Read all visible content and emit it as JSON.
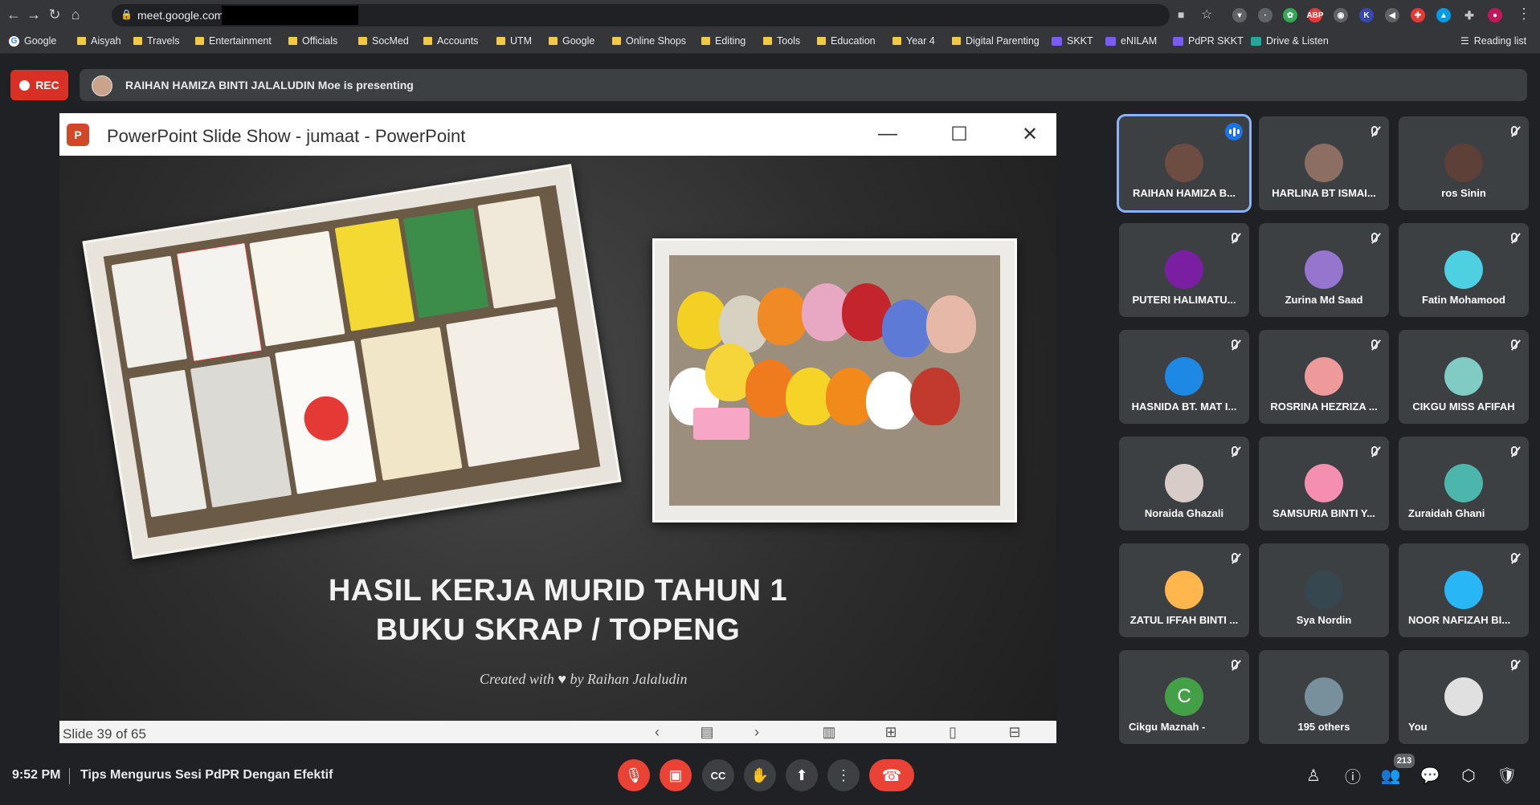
{
  "browser": {
    "url": "meet.google.com",
    "bookmarks": [
      {
        "label": "Google",
        "icon": "google-icon"
      },
      {
        "label": "Aisyah",
        "icon": "folder-icon"
      },
      {
        "label": "Travels",
        "icon": "folder-icon"
      },
      {
        "label": "Entertainment",
        "icon": "folder-icon"
      },
      {
        "label": "Officials",
        "icon": "folder-icon"
      },
      {
        "label": "SocMed",
        "icon": "folder-icon"
      },
      {
        "label": "Accounts",
        "icon": "folder-icon"
      },
      {
        "label": "UTM",
        "icon": "folder-icon"
      },
      {
        "label": "Google",
        "icon": "folder-icon"
      },
      {
        "label": "Online Shops",
        "icon": "folder-icon"
      },
      {
        "label": "Editing",
        "icon": "folder-icon"
      },
      {
        "label": "Tools",
        "icon": "folder-icon"
      },
      {
        "label": "Education",
        "icon": "folder-icon"
      },
      {
        "label": "Year 4",
        "icon": "folder-icon"
      },
      {
        "label": "Digital Parenting",
        "icon": "folder-icon"
      },
      {
        "label": "SKKT",
        "icon": "app-icon"
      },
      {
        "label": "eNILAM",
        "icon": "app-icon"
      },
      {
        "label": "PdPR SKKT",
        "icon": "app-icon"
      },
      {
        "label": "Drive & Listen",
        "icon": "drive-icon"
      }
    ],
    "reading_list": "Reading list",
    "extensions": [
      {
        "label": "ABP",
        "color": "#e53935"
      },
      {
        "label": "K",
        "color": "#3949ab"
      },
      {
        "label": "✚",
        "color": "#e53935"
      }
    ]
  },
  "meet": {
    "rec_label": "REC",
    "presenting_text": "RAIHAN HAMIZA BINTI JALALUDIN Moe is presenting",
    "time": "9:52 PM",
    "meeting_name": "Tips Mengurus Sesi PdPR Dengan Efektif",
    "participant_count_badge": "213",
    "participants": [
      {
        "name": "RAIHAN HAMIZA B...",
        "speaking": true,
        "avatar_color": "#6d4c41"
      },
      {
        "name": "HARLINA BT ISMAI...",
        "muted": true,
        "avatar_color": "#8d6e63"
      },
      {
        "name": "ros Sinin",
        "muted": true,
        "avatar_color": "#5d4037"
      },
      {
        "name": "PUTERI HALIMATU...",
        "muted": true,
        "avatar_color": "#7b1fa2"
      },
      {
        "name": "Zurina Md Saad",
        "muted": true,
        "avatar_color": "#9575cd"
      },
      {
        "name": "Fatin Mohamood",
        "muted": true,
        "avatar_color": "#4dd0e1"
      },
      {
        "name": "HASNIDA BT. MAT I...",
        "muted": true,
        "avatar_color": "#1e88e5"
      },
      {
        "name": "ROSRINA HEZRIZA ...",
        "muted": true,
        "avatar_color": "#ef9a9a"
      },
      {
        "name": "CIKGU MISS AFIFAH",
        "muted": true,
        "avatar_color": "#80cbc4"
      },
      {
        "name": "Noraida Ghazali",
        "muted": true,
        "avatar_color": "#d7ccc8"
      },
      {
        "name": "SAMSURIA BINTI Y...",
        "muted": true,
        "avatar_color": "#f48fb1"
      },
      {
        "name": "Zuraidah Ghani",
        "muted": true,
        "avatar_color": "#4db6ac"
      },
      {
        "name": "ZATUL IFFAH BINTI ...",
        "muted": true,
        "avatar_color": "#ffb74d"
      },
      {
        "name": "Sya Nordin",
        "muted": false,
        "avatar_color": "#37474f"
      },
      {
        "name": "NOOR NAFIZAH BI...",
        "muted": true,
        "avatar_color": "#29b6f6"
      },
      {
        "name": "Cikgu Maznah -",
        "muted": true,
        "avatar_color": "#43a047",
        "initial": "C"
      },
      {
        "name": "195 others",
        "muted": false,
        "avatar_color": "#78909c"
      },
      {
        "name": "You",
        "muted": true,
        "avatar_color": "#e0e0e0"
      }
    ]
  },
  "ppt": {
    "window_title": "PowerPoint Slide Show  -  jumaat - PowerPoint",
    "logo_letter": "P",
    "slide_title_line1": "HASIL KERJA MURID TAHUN 1",
    "slide_title_line2": "BUKU SKRAP / TOPENG",
    "credit_prefix": "Created with",
    "credit_suffix": "by Raihan Jalaludin",
    "slide_counter": "Slide 39 of 65"
  },
  "colors": {
    "rec_red": "#d93025",
    "hangup_red": "#ea4335",
    "active_border": "#8ab4f8",
    "speaking_blue": "#1a73e8"
  }
}
